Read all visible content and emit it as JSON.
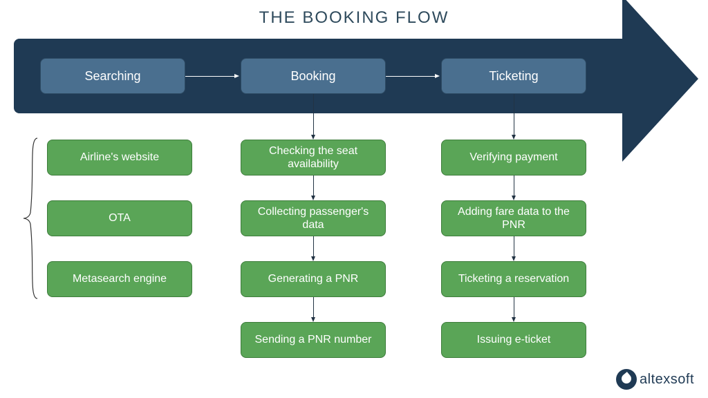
{
  "title": "THE BOOKING FLOW",
  "stages": {
    "searching": "Searching",
    "booking": "Booking",
    "ticketing": "Ticketing"
  },
  "searching_items": [
    "Airline's website",
    "OTA",
    "Metasearch engine"
  ],
  "booking_items": [
    "Checking the seat availability",
    "Collecting passenger's data",
    "Generating a PNR",
    "Sending a PNR number"
  ],
  "ticketing_items": [
    "Verifying payment",
    "Adding fare data to the PNR",
    "Ticketing a reservation",
    "Issuing e-ticket"
  ],
  "logo": "altexsoft",
  "colors": {
    "arrow_bg": "#1f3a54",
    "stage_bg": "#4a6f8f",
    "step_bg": "#5aa557"
  }
}
